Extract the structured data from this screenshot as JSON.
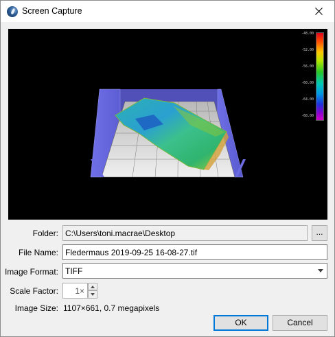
{
  "window": {
    "title": "Screen Capture"
  },
  "colors": {
    "accent": "#0078d7",
    "viewport_bg": "#000000"
  },
  "viewport": {
    "colorbar_ticks": [
      "-48.00",
      "-52.00",
      "-56.00",
      "-60.00",
      "-64.00",
      "-68.00"
    ]
  },
  "form": {
    "folder": {
      "label": "Folder:",
      "value": "C:\\Users\\toni.macrae\\Desktop",
      "browse_label": "..."
    },
    "file_name": {
      "label": "File Name:",
      "value": "Fledermaus 2019-09-25 16-08-27.tif"
    },
    "image_format": {
      "label": "Image Format:",
      "value": "TIFF"
    },
    "scale_factor": {
      "label": "Scale Factor:",
      "value": "1×"
    },
    "image_size": {
      "label": "Image Size:",
      "value": "1107×661, 0.7 megapixels"
    }
  },
  "buttons": {
    "ok": "OK",
    "cancel": "Cancel"
  },
  "icons": {
    "app": "fledermaus-app-icon",
    "close": "close-icon",
    "caret": "chevron-down-icon"
  }
}
